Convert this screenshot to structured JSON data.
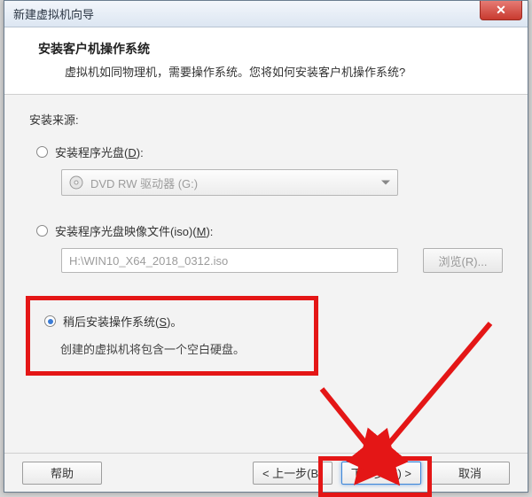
{
  "titlebar": {
    "title": "新建虚拟机向导"
  },
  "header": {
    "title": "安装客户机操作系统",
    "subtitle": "虚拟机如同物理机，需要操作系统。您将如何安装客户机操作系统?"
  },
  "source": {
    "label": "安装来源:",
    "opt_disc": {
      "label": "安装程序光盘(",
      "mnemonic": "D",
      "tail": "):"
    },
    "disc_dropdown": "DVD RW 驱动器 (G:)",
    "opt_iso": {
      "label": "安装程序光盘映像文件(iso)(",
      "mnemonic": "M",
      "tail": "):"
    },
    "iso_path": "H:\\WIN10_X64_2018_0312.iso",
    "browse": "浏览(R)...",
    "opt_later": {
      "label": "稍后安装操作系统(",
      "mnemonic": "S",
      "tail": ")。"
    },
    "later_hint": "创建的虚拟机将包含一个空白硬盘。"
  },
  "footer": {
    "help": "帮助",
    "back": "< 上一步(B)",
    "next": "下一步(N) >",
    "cancel": "取消"
  }
}
